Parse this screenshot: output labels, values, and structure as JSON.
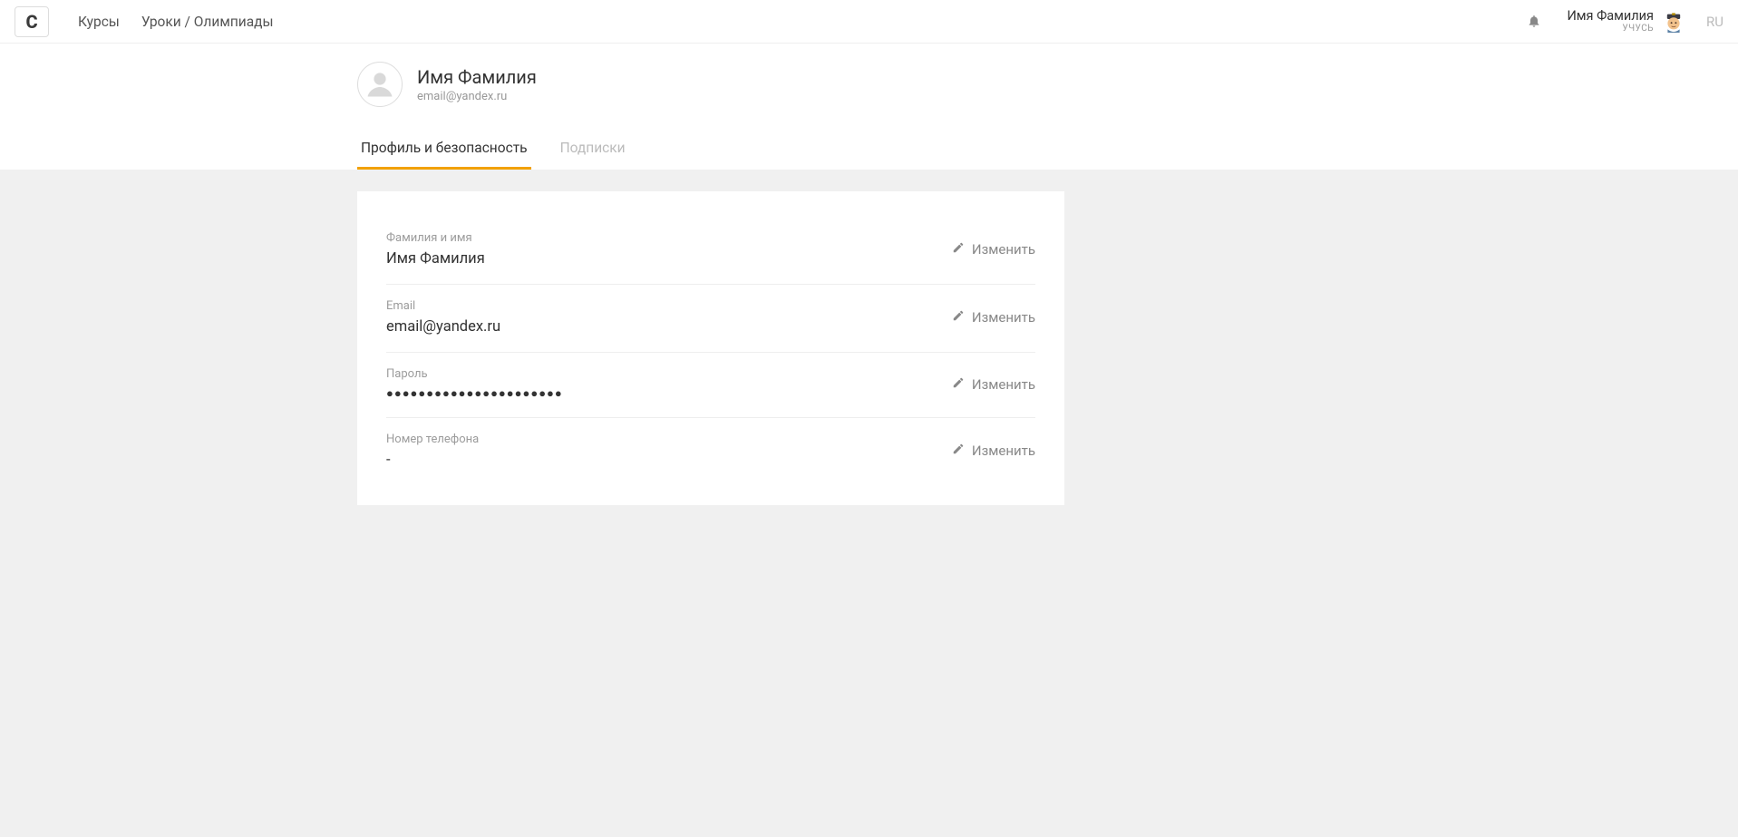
{
  "nav": {
    "logo_text": "C",
    "links": [
      "Курсы",
      "Уроки / Олимпиады"
    ]
  },
  "topbar": {
    "user_name": "Имя Фамилия",
    "user_role": "УЧУСЬ",
    "language": "RU"
  },
  "profile_header": {
    "display_name": "Имя Фамилия",
    "email": "email@yandex.ru"
  },
  "tabs": {
    "profile_security": "Профиль и безопасность",
    "subscriptions": "Подписки"
  },
  "fields": {
    "name": {
      "label": "Фамилия и имя",
      "value": "Имя Фамилия",
      "edit_label": "Изменить"
    },
    "email": {
      "label": "Email",
      "value": "email@yandex.ru",
      "edit_label": "Изменить"
    },
    "password": {
      "label": "Пароль",
      "value": "●●●●●●●●●●●●●●●●●●●●●●",
      "edit_label": "Изменить"
    },
    "phone": {
      "label": "Номер телефона",
      "value": "-",
      "edit_label": "Изменить"
    }
  }
}
